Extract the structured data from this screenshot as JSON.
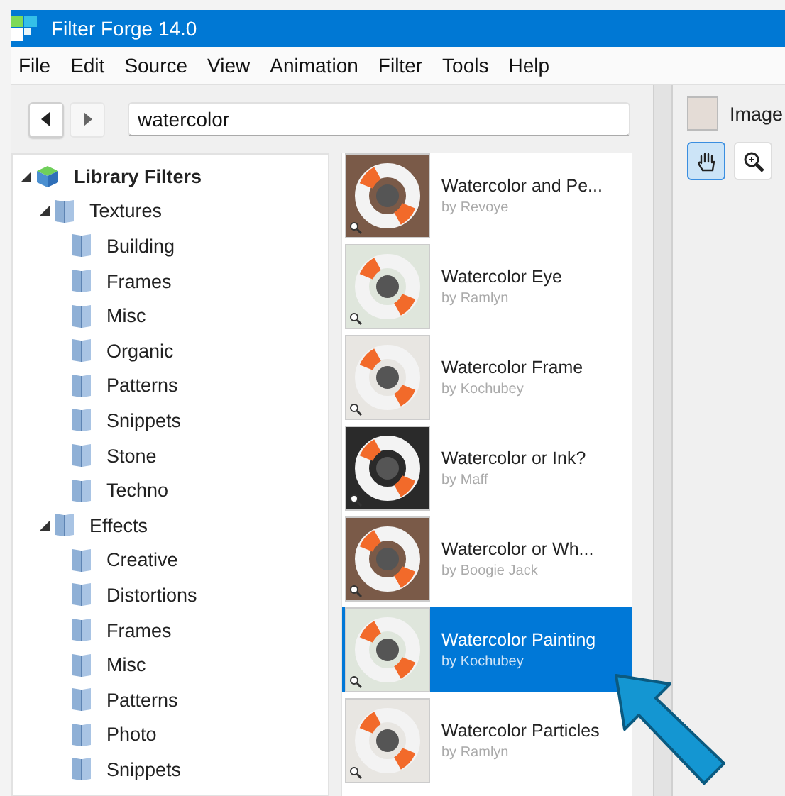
{
  "window": {
    "title": "Filter Forge 14.0"
  },
  "menu": [
    "File",
    "Edit",
    "Source",
    "View",
    "Animation",
    "Filter",
    "Tools",
    "Help"
  ],
  "search": {
    "value": "watercolor"
  },
  "tree": [
    {
      "label": "Library Filters",
      "expanded": true,
      "children": [
        {
          "label": "Textures",
          "expanded": true,
          "children": [
            {
              "label": "Building"
            },
            {
              "label": "Frames"
            },
            {
              "label": "Misc"
            },
            {
              "label": "Organic"
            },
            {
              "label": "Patterns"
            },
            {
              "label": "Snippets"
            },
            {
              "label": "Stone"
            },
            {
              "label": "Techno"
            }
          ]
        },
        {
          "label": "Effects",
          "expanded": true,
          "children": [
            {
              "label": "Creative"
            },
            {
              "label": "Distortions"
            },
            {
              "label": "Frames"
            },
            {
              "label": "Misc"
            },
            {
              "label": "Patterns"
            },
            {
              "label": "Photo"
            },
            {
              "label": "Snippets"
            }
          ]
        }
      ]
    }
  ],
  "filters": [
    {
      "title": "Watercolor and Pe...",
      "author": "by Revoye",
      "selected": false
    },
    {
      "title": "Watercolor Eye",
      "author": "by Ramlyn",
      "selected": false
    },
    {
      "title": "Watercolor Frame",
      "author": "by Kochubey",
      "selected": false
    },
    {
      "title": "Watercolor or Ink?",
      "author": "by Maff",
      "selected": false
    },
    {
      "title": "Watercolor or Wh...",
      "author": "by Boogie Jack",
      "selected": false
    },
    {
      "title": "Watercolor Painting",
      "author": "by Kochubey",
      "selected": true
    },
    {
      "title": "Watercolor Particles",
      "author": "by Ramlyn",
      "selected": false
    }
  ],
  "preview": {
    "tab": "Image",
    "tools": [
      {
        "kind": "hand",
        "selected": true
      },
      {
        "kind": "zoom",
        "selected": false
      }
    ]
  }
}
